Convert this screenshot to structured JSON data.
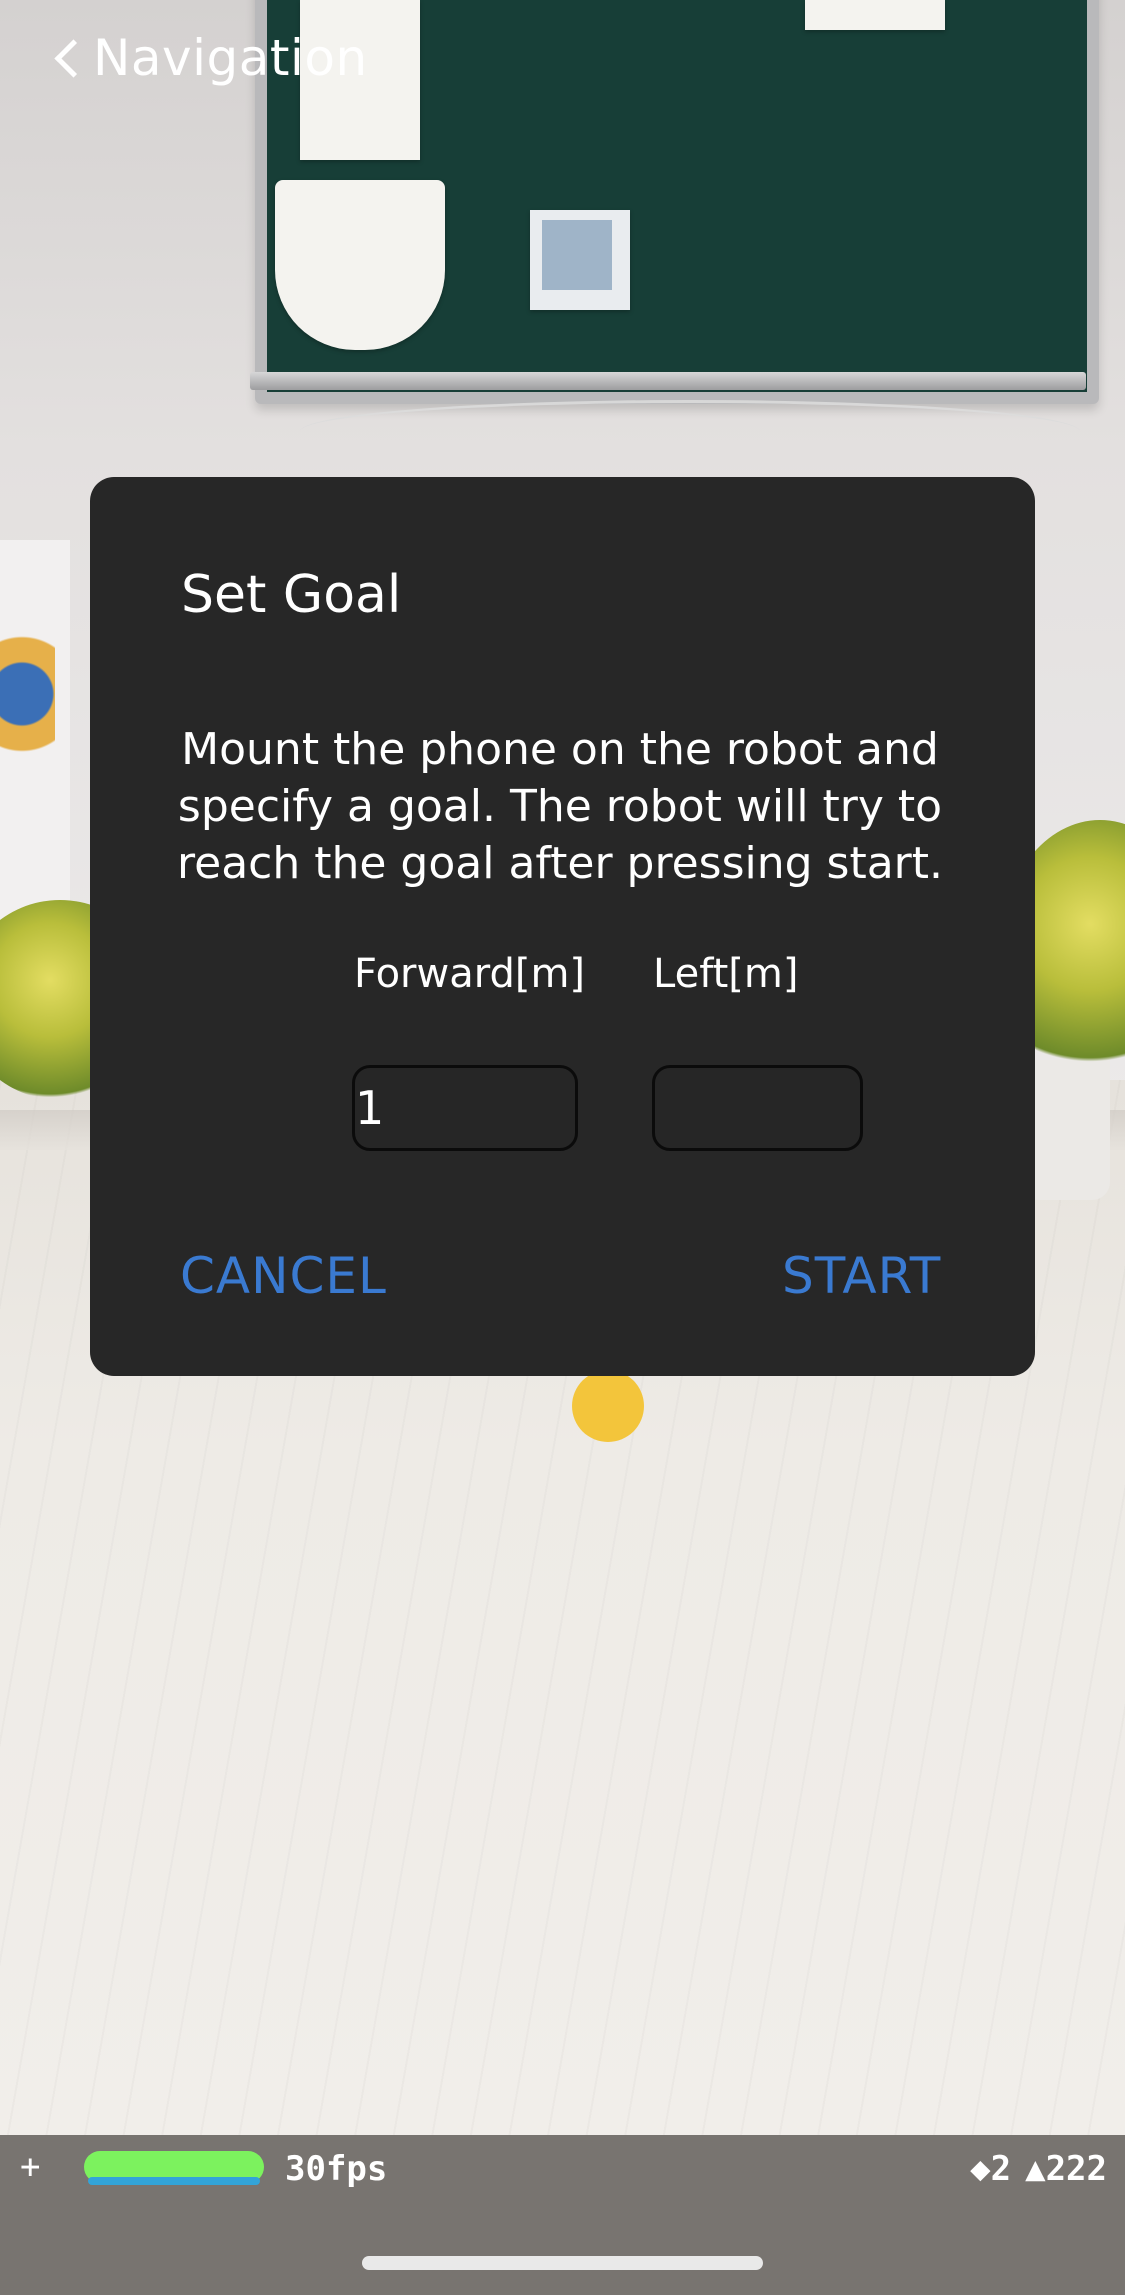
{
  "nav": {
    "back_label": "Navigation"
  },
  "dialog": {
    "title": "Set Goal",
    "message": "Mount the phone on the robot and specify a goal. The robot will try to reach the goal after pressing start.",
    "forward_label": "Forward[m]",
    "left_label": "Left[m]",
    "forward_value": "1",
    "left_value": "",
    "cancel_label": "CANCEL",
    "start_label": "START"
  },
  "status": {
    "fps_text": "30fps",
    "fps_level": 1.0,
    "vertices": "◆2",
    "triangles": "▲222",
    "plus_glyph": "+"
  },
  "colors": {
    "dialog_bg": "#272727",
    "button_blue": "#3a7ad1",
    "goal_marker": "#f3c53b",
    "fps_bar_green": "#7cf25e"
  }
}
